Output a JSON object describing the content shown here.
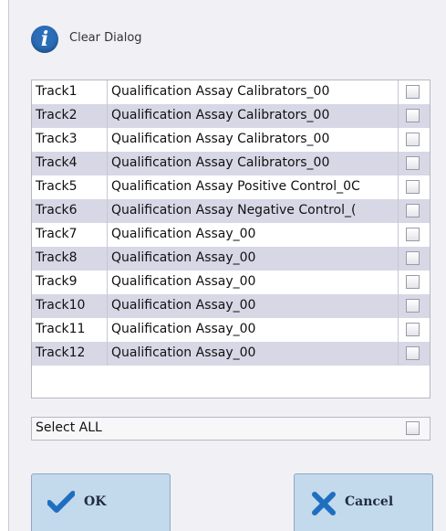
{
  "dialog": {
    "title": "Clear Dialog",
    "title_icon": "info-icon"
  },
  "tracks": [
    {
      "name": "Track1",
      "assay": "Qualification Assay Calibrators_00",
      "checked": false
    },
    {
      "name": "Track2",
      "assay": "Qualification Assay Calibrators_00",
      "checked": false
    },
    {
      "name": "Track3",
      "assay": "Qualification Assay Calibrators_00",
      "checked": false
    },
    {
      "name": "Track4",
      "assay": "Qualification Assay Calibrators_00",
      "checked": false
    },
    {
      "name": "Track5",
      "assay": "Qualification Assay Positive Control_0C",
      "checked": false
    },
    {
      "name": "Track6",
      "assay": "Qualification Assay Negative Control_(",
      "checked": false
    },
    {
      "name": "Track7",
      "assay": "Qualification Assay_00",
      "checked": false
    },
    {
      "name": "Track8",
      "assay": "Qualification Assay_00",
      "checked": false
    },
    {
      "name": "Track9",
      "assay": "Qualification Assay_00",
      "checked": false
    },
    {
      "name": "Track10",
      "assay": "Qualification Assay_00",
      "checked": false
    },
    {
      "name": "Track11",
      "assay": "Qualification Assay_00",
      "checked": false
    },
    {
      "name": "Track12",
      "assay": "Qualification Assay_00",
      "checked": false
    }
  ],
  "select_all": {
    "label": "Select ALL",
    "checked": false
  },
  "buttons": {
    "ok": {
      "label": "OK",
      "icon": "checkmark-icon"
    },
    "cancel": {
      "label": "Cancel",
      "icon": "x-icon"
    }
  },
  "colors": {
    "row_alt": "#d7d7e6",
    "button_bg": "#c3d9ec",
    "icon_blue": "#2b6db8"
  }
}
